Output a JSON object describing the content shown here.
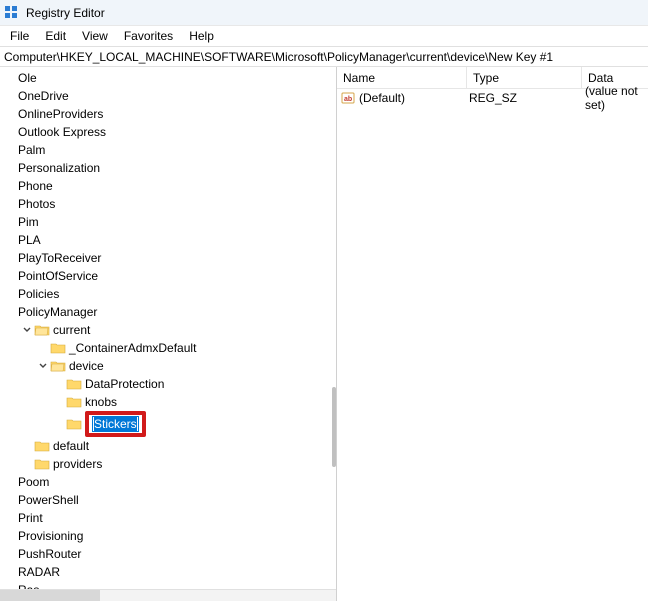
{
  "title": "Registry Editor",
  "menubar": [
    "File",
    "Edit",
    "View",
    "Favorites",
    "Help"
  ],
  "address": "Computer\\HKEY_LOCAL_MACHINE\\SOFTWARE\\Microsoft\\PolicyManager\\current\\device\\New Key #1",
  "tree": [
    {
      "label": "Ole",
      "indent": 0,
      "folder": false
    },
    {
      "label": "OneDrive",
      "indent": 0,
      "folder": false
    },
    {
      "label": "OnlineProviders",
      "indent": 0,
      "folder": false
    },
    {
      "label": "Outlook Express",
      "indent": 0,
      "folder": false
    },
    {
      "label": "Palm",
      "indent": 0,
      "folder": false
    },
    {
      "label": "Personalization",
      "indent": 0,
      "folder": false
    },
    {
      "label": "Phone",
      "indent": 0,
      "folder": false
    },
    {
      "label": "Photos",
      "indent": 0,
      "folder": false
    },
    {
      "label": "Pim",
      "indent": 0,
      "folder": false
    },
    {
      "label": "PLA",
      "indent": 0,
      "folder": false
    },
    {
      "label": "PlayToReceiver",
      "indent": 0,
      "folder": false
    },
    {
      "label": "PointOfService",
      "indent": 0,
      "folder": false
    },
    {
      "label": "Policies",
      "indent": 0,
      "folder": false
    },
    {
      "label": "PolicyManager",
      "indent": 0,
      "folder": false
    },
    {
      "label": "current",
      "indent": 1,
      "folder": true,
      "expanded": true
    },
    {
      "label": "_ContainerAdmxDefault",
      "indent": 2,
      "folder": true
    },
    {
      "label": "device",
      "indent": 2,
      "folder": true,
      "expanded": true,
      "chevron": true
    },
    {
      "label": "DataProtection",
      "indent": 3,
      "folder": true
    },
    {
      "label": "knobs",
      "indent": 3,
      "folder": true
    },
    {
      "label": "Stickers",
      "indent": 3,
      "folder": true,
      "editing": true,
      "highlight": true
    },
    {
      "label": "default",
      "indent": 1,
      "folder": true
    },
    {
      "label": "providers",
      "indent": 1,
      "folder": true
    },
    {
      "label": "Poom",
      "indent": 0,
      "folder": false
    },
    {
      "label": "PowerShell",
      "indent": 0,
      "folder": false
    },
    {
      "label": "Print",
      "indent": 0,
      "folder": false
    },
    {
      "label": "Provisioning",
      "indent": 0,
      "folder": false
    },
    {
      "label": "PushRouter",
      "indent": 0,
      "folder": false
    },
    {
      "label": "RADAR",
      "indent": 0,
      "folder": false
    },
    {
      "label": "Ras",
      "indent": 0,
      "folder": false
    }
  ],
  "values_header": {
    "name": "Name",
    "type": "Type",
    "data": "Data"
  },
  "values": [
    {
      "icon": "string-value-icon",
      "name": "(Default)",
      "type": "REG_SZ",
      "data": "(value not set)"
    }
  ]
}
